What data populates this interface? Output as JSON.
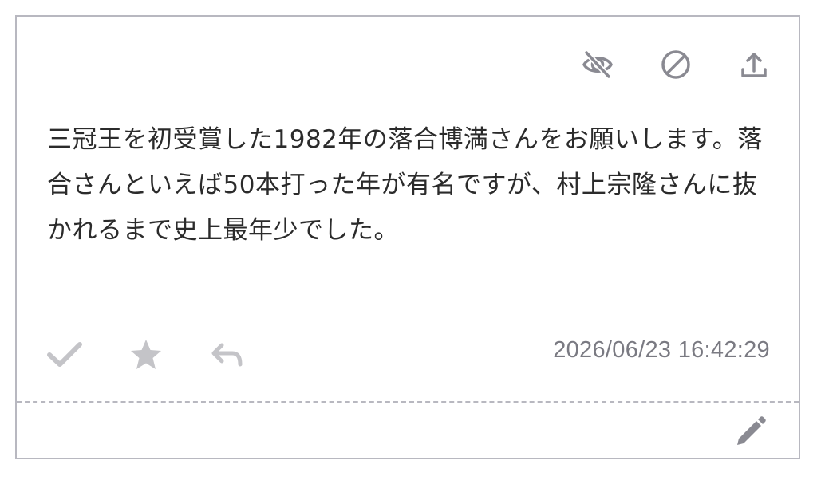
{
  "card": {
    "message": "三冠王を初受賞した1982年の落合博満さんをお願いします。落合さんといえば50本打った年が有名ですが、村上宗隆さんに抜かれるまで史上最年少でした。",
    "timestamp": "2026/06/23 16:42:29",
    "top_actions": [
      {
        "name": "hide-button",
        "icon": "eye-slash-icon"
      },
      {
        "name": "block-button",
        "icon": "ban-icon"
      },
      {
        "name": "share-button",
        "icon": "upload-icon"
      }
    ],
    "bottom_actions": [
      {
        "name": "check-button",
        "icon": "check-icon"
      },
      {
        "name": "favorite-button",
        "icon": "star-icon"
      },
      {
        "name": "reply-button",
        "icon": "reply-icon"
      }
    ],
    "edit_action": {
      "name": "edit-button",
      "icon": "pencil-icon"
    }
  },
  "colors": {
    "border": "#b8b8c0",
    "icon_dark": "#8a8a92",
    "icon_light": "#c4c4c8",
    "text": "#2b2b2b",
    "timestamp": "#7a7a82"
  }
}
